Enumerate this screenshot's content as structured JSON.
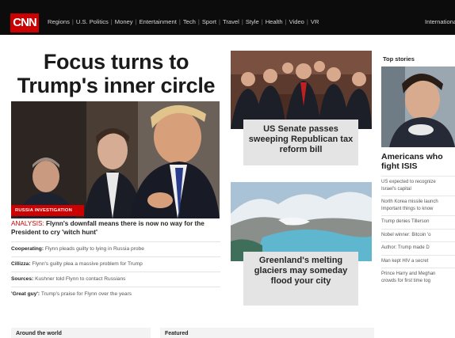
{
  "nav": {
    "logo": "CNN",
    "links": [
      "Regions",
      "U.S. Politics",
      "Money",
      "Entertainment",
      "Tech",
      "Sport",
      "Travel",
      "Style",
      "Health",
      "Video",
      "VR"
    ],
    "right_link": "International"
  },
  "hero": {
    "title_line1": "Focus turns to",
    "title_line2": "Trump's inner circle",
    "badge": "RUSSIA INVESTIGATION",
    "analysis_tag": "ANALYSIS:",
    "analysis_text": "Flynn's downfall means there is now no way for the President to cry 'witch hunt'"
  },
  "stories": [
    {
      "label": "Cooperating:",
      "text": "Flynn pleads guilty to lying in Russia probe"
    },
    {
      "label": "Cillizza:",
      "text": "Flynn's guilty plea a massive problem for Trump"
    },
    {
      "label": "Sources:",
      "text": "Kushner told Flynn to contact Russians"
    },
    {
      "label": "'Great guy':",
      "text": "Trump's praise for Flynn over the years"
    }
  ],
  "middle": {
    "senate_caption": "US Senate passes sweeping Republican tax reform bill",
    "greenland_caption": "Greenland's melting glaciers may someday flood your city"
  },
  "top_stories": {
    "label": "Top stories",
    "headline_line1": "Americans who",
    "headline_line2": "fight ISIS",
    "items": [
      [
        "US expected to recognize",
        "Israel's capital"
      ],
      [
        "North Korea missile launch",
        "Important things to know"
      ],
      [
        "Trump denies Tillerson"
      ],
      [
        "Nobel winner: Bitcoin 'o"
      ],
      [
        "Author: Trump made D"
      ],
      [
        "Man kept HIV a secret"
      ],
      [
        "Prince Harry and Meghan",
        "crowds for first time tog"
      ]
    ]
  },
  "bottom": {
    "section1": "Around the world",
    "section2": "Featured"
  },
  "colors": {
    "brand_red": "#cc0000",
    "nav_bg": "#0c0c0c",
    "caption_bg": "#e4e4e4"
  }
}
